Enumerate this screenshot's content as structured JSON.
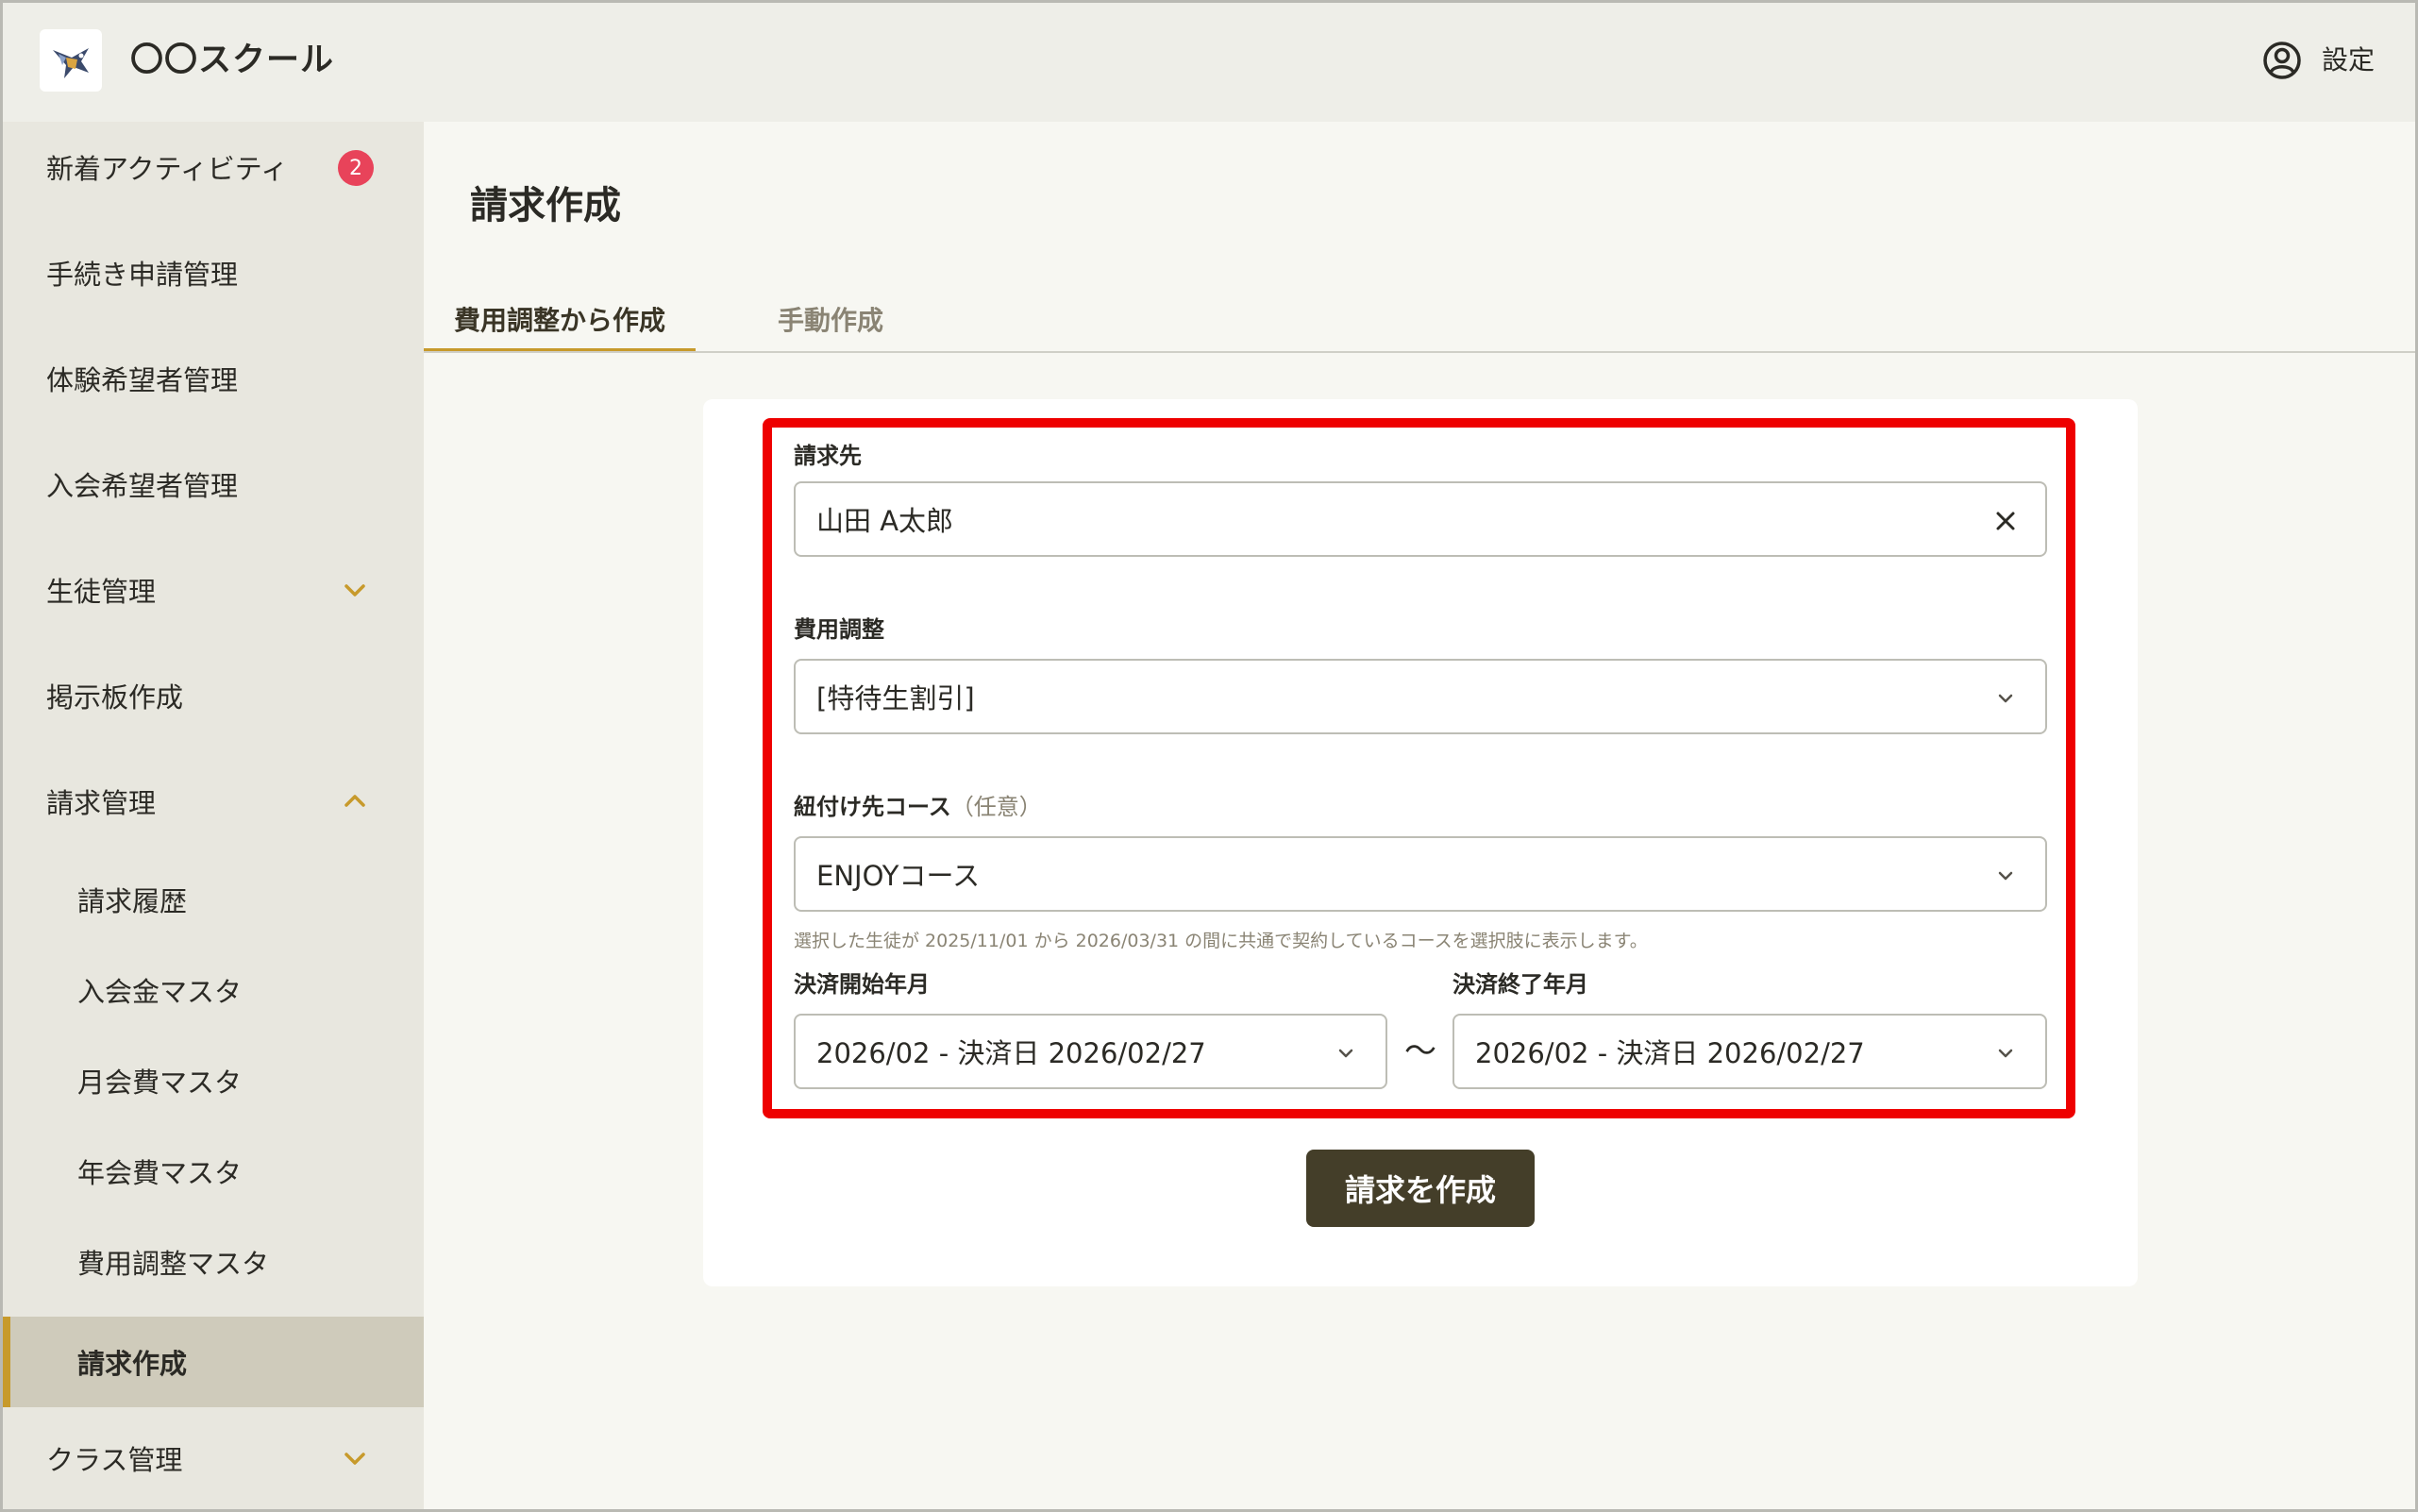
{
  "header": {
    "app_name": "〇〇スクール",
    "settings_label": "設定"
  },
  "sidebar": {
    "items": [
      {
        "label": "新着アクティビティ",
        "badge": "2"
      },
      {
        "label": "手続き申請管理"
      },
      {
        "label": "体験希望者管理"
      },
      {
        "label": "入会希望者管理"
      },
      {
        "label": "生徒管理",
        "expandable": "collapsed"
      },
      {
        "label": "掲示板作成"
      },
      {
        "label": "請求管理",
        "expandable": "expanded"
      },
      {
        "label": "請求履歴"
      },
      {
        "label": "入会金マスタ"
      },
      {
        "label": "月会費マスタ"
      },
      {
        "label": "年会費マスタ"
      },
      {
        "label": "費用調整マスタ"
      },
      {
        "label": "請求作成",
        "active": "true"
      },
      {
        "label": "クラス管理",
        "expandable": "collapsed"
      }
    ]
  },
  "main": {
    "title": "請求作成",
    "tabs": [
      {
        "label": "費用調整から作成",
        "active": "true"
      },
      {
        "label": "手動作成"
      }
    ],
    "form": {
      "billing_to": {
        "label": "請求先",
        "value": "山田 A太郎"
      },
      "fee_adjustment": {
        "label": "費用調整",
        "value": "[特待生割引]"
      },
      "course": {
        "label": "紐付け先コース",
        "optional": "（任意）",
        "value": "ENJOYコース",
        "hint": "選択した生徒が 2025/11/01 から 2026/03/31 の間に共通で契約しているコースを選択肢に表示します。"
      },
      "start_month": {
        "label": "決済開始年月",
        "value": "2026/02 - 決済日 2026/02/27"
      },
      "range_separator": "〜",
      "end_month": {
        "label": "決済終了年月",
        "value": "2026/02 - 決済日 2026/02/27"
      },
      "submit_label": "請求を作成"
    }
  },
  "colors": {
    "accent": "#c79a2b",
    "badge": "#e8435a",
    "highlight": "#ee0000",
    "submit": "#443e29"
  }
}
